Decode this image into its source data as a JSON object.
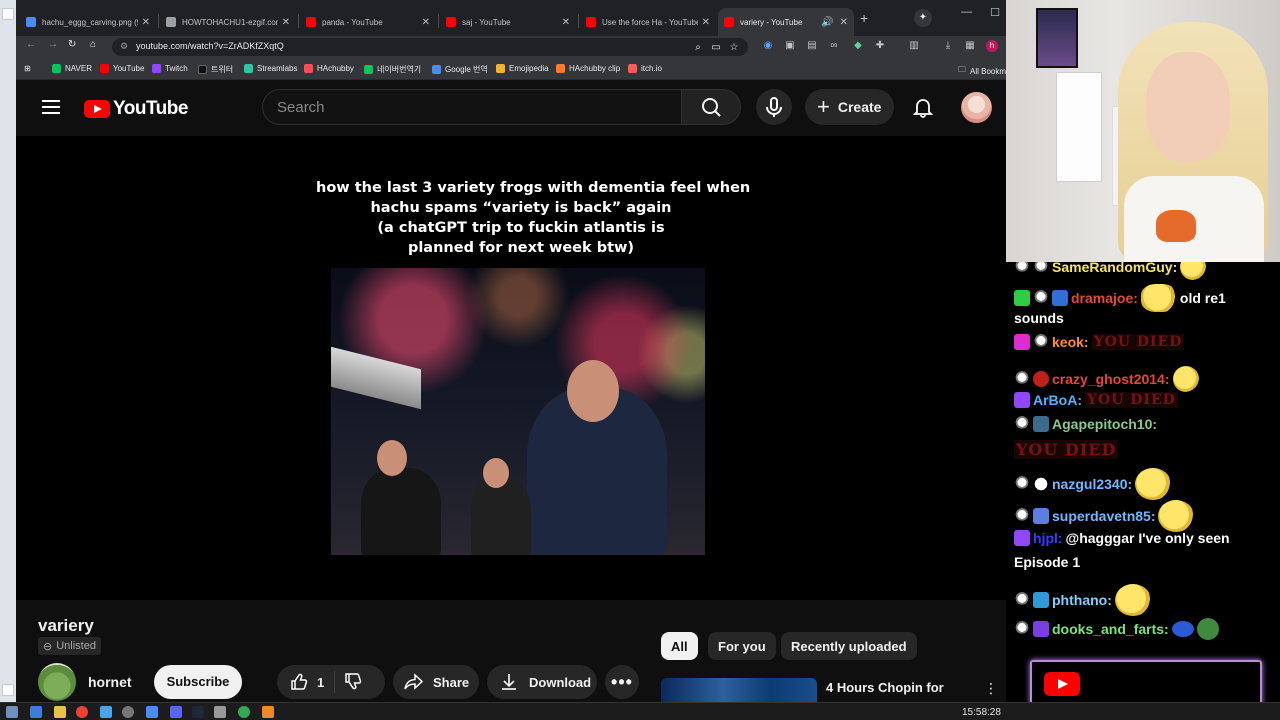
{
  "browser": {
    "tabs": [
      {
        "title": "hachu_eggg_carving.png (96",
        "active": false,
        "favicon_color": "#4c8bf5"
      },
      {
        "title": "HOWTOHACHU1-ezgif.com",
        "active": false,
        "favicon_color": "#9aa0a6"
      },
      {
        "title": "panda - YouTube",
        "active": false,
        "favicon_color": "#ff0000"
      },
      {
        "title": "saj - YouTube",
        "active": false,
        "favicon_color": "#ff0000"
      },
      {
        "title": "Use the force Ha - YouTube",
        "active": false,
        "favicon_color": "#ff0000"
      },
      {
        "title": "variery - YouTube",
        "active": true,
        "favicon_color": "#ff0000"
      }
    ],
    "url": "youtube.com/watch?v=ZrADKfZXqtQ",
    "bookmarks": [
      {
        "label": "NAVER",
        "color": "#03c75a"
      },
      {
        "label": "YouTube",
        "color": "#ff0000"
      },
      {
        "label": "Twitch",
        "color": "#9146ff"
      },
      {
        "label": "트위터",
        "color": "#111111"
      },
      {
        "label": "Streamlabs",
        "color": "#31c3a2"
      },
      {
        "label": "HAchubby",
        "color": "#ff4a5a"
      },
      {
        "label": "네이버번역기",
        "color": "#03c75a"
      },
      {
        "label": "Google 번역",
        "color": "#4c8bf5"
      },
      {
        "label": "Emojipedia",
        "color": "#f2b233"
      },
      {
        "label": "HAchubby clip",
        "color": "#ff7b2a"
      },
      {
        "label": "itch.io",
        "color": "#fa5c5c"
      }
    ],
    "all_bookmarks": "All Bookm"
  },
  "youtube": {
    "logo_text": "YouTube",
    "search_placeholder": "Search",
    "create_label": "Create",
    "caption": [
      "how the last 3 variety frogs with dementia feel when",
      "hachu spams “variety is back” again",
      "(a chatGPT trip to fuckin atlantis is",
      "planned for next week btw)"
    ],
    "video_title": "variery",
    "visibility": "Unlisted",
    "channel_name": "hornet",
    "subscribe_label": "Subscribe",
    "like_count": "1",
    "share_label": "Share",
    "download_label": "Download",
    "chips": [
      "All",
      "For you",
      "Recently uploaded"
    ],
    "recommended_title": "4 Hours Chopin for"
  },
  "chat": {
    "messages": [
      {
        "user": "SameRandomGuy:",
        "color": "#f6e36b",
        "text": ""
      },
      {
        "user": "dramajoe:",
        "color": "#e0483a",
        "text": "old re1"
      },
      {
        "user": "",
        "color": "#ffffff",
        "text": "sounds"
      },
      {
        "user": "keok:",
        "color": "#ff8c2e",
        "text": "YOU DIED"
      },
      {
        "user": "crazy_ghost2014:",
        "color": "#e0483a",
        "text": ""
      },
      {
        "user": "ArBoA:",
        "color": "#4bb6ff",
        "text": "YOU DIED"
      },
      {
        "user": "Agapepitoch10:",
        "color": "#8bc88b",
        "text": ""
      },
      {
        "user": "",
        "color": "#ffffff",
        "text": "YOU DIED"
      },
      {
        "user": "nazgul2340:",
        "color": "#6fb8ff",
        "text": ""
      },
      {
        "user": "superdavetn85:",
        "color": "#6fb8ff",
        "text": ""
      },
      {
        "user": "hjpl:",
        "color": "#3a3aff",
        "text": "@hagggar I've only seen"
      },
      {
        "user": "",
        "color": "#ffffff",
        "text": "Episode 1"
      },
      {
        "user": "phthano:",
        "color": "#7fd0ff",
        "text": ""
      },
      {
        "user": "dooks_and_farts:",
        "color": "#7ee07e",
        "text": ""
      }
    ]
  },
  "taskbar": {
    "clock": "15:58:28"
  }
}
